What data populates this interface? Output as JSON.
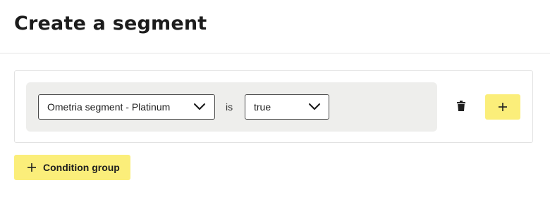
{
  "page": {
    "title": "Create a segment"
  },
  "condition_group": {
    "conditions": [
      {
        "field": "Ometria segment - Platinum",
        "operator": "is",
        "value": "true"
      }
    ],
    "icons": {
      "delete": "trash-icon",
      "add": "plus-icon",
      "dropdown": "chevron-down-icon"
    }
  },
  "actions": {
    "add_condition_group_label": "Condition group"
  },
  "colors": {
    "accent_yellow": "#fbee7a",
    "row_background": "#eeeeec",
    "border": "#4a4a4a"
  }
}
